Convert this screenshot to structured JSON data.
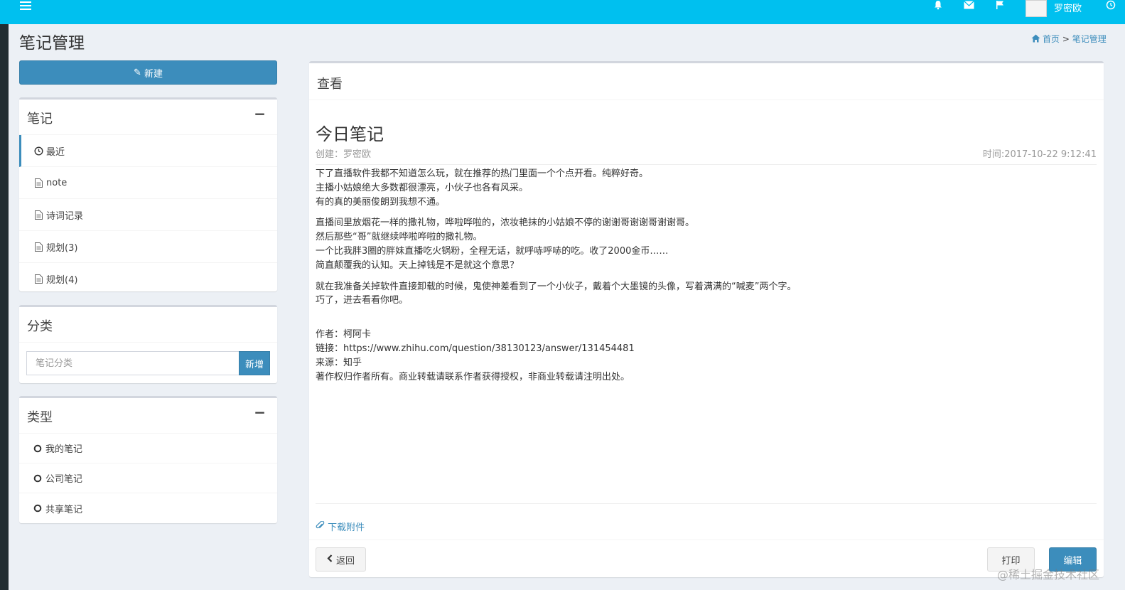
{
  "topbar": {
    "username": "罗密欧",
    "icons": [
      "menu-icon",
      "bell-icon",
      "envelope-icon",
      "flag-icon",
      "avatar",
      "clock-icon"
    ],
    "color": "#00c0ef"
  },
  "page": {
    "title": "笔记管理",
    "breadcrumb": {
      "home": "首页",
      "separator": ">",
      "current": "笔记管理"
    }
  },
  "sidebar": {
    "new_button": "新建",
    "notes_box": {
      "title": "笔记",
      "collapse": "−",
      "items": [
        {
          "label": "最近",
          "icon": "clock-icon"
        },
        {
          "label": "note",
          "icon": "file-icon"
        },
        {
          "label": "诗词记录",
          "icon": "file-icon"
        },
        {
          "label": "规划(3)",
          "icon": "file-icon"
        },
        {
          "label": "规划(4)",
          "icon": "file-icon"
        }
      ]
    },
    "category_box": {
      "title": "分类",
      "input_placeholder": "笔记分类",
      "add_button": "新增"
    },
    "type_box": {
      "title": "类型",
      "collapse": "−",
      "items": [
        {
          "label": "我的笔记",
          "icon": "circle-icon"
        },
        {
          "label": "公司笔记",
          "icon": "circle-icon"
        },
        {
          "label": "共享笔记",
          "icon": "circle-icon"
        }
      ]
    }
  },
  "main": {
    "header": "查看",
    "note_title": "今日笔记",
    "author": "创建：罗密欧",
    "time": "时间:2017-10-22 9:12:41",
    "paragraphs": [
      [
        "下了直播软件我都不知道怎么玩，就在推荐的热门里面一个个点开看。纯粹好奇。",
        "主播小姑娘绝大多数都很漂亮，小伙子也各有风采。",
        "有的真的美丽俊朗到我想不通。"
      ],
      [
        "直播间里放烟花一样的撒礼物，哗啦哗啦的，浓妆艳抹的小姑娘不停的谢谢哥谢谢哥谢谢哥。",
        "然后那些“哥”就继续哗啦哗啦的撒礼物。",
        "一个比我胖3圈的胖妹直播吃火锅粉，全程无话，就呼哧呼哧的吃。收了2000金币……",
        "简直颠覆我的认知。天上掉钱是不是就这个意思？"
      ],
      [
        "就在我准备关掉软件直接卸载的时候，鬼使神差看到了一个小伙子，戴着个大墨镜的头像，写着满满的“喊麦”两个字。",
        "巧了，进去看看你吧。"
      ]
    ],
    "footer_lines": [
      "作者：柯阿卡",
      "链接：https://www.zhihu.com/question/38130123/answer/131454481",
      "来源：知乎",
      "著作权归作者所有。商业转载请联系作者获得授权，非商业转载请注明出处。"
    ],
    "attachment": "下载附件",
    "back_button": "返回",
    "print_button": "打印",
    "edit_button": "编辑"
  },
  "watermark": "@稀土掘金技术社区"
}
